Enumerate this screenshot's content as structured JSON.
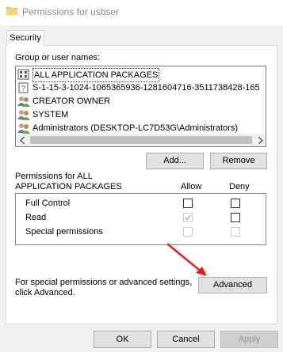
{
  "window": {
    "title": "Permissions for usbser"
  },
  "tabs": [
    {
      "label": "Security"
    }
  ],
  "group_list": {
    "label": "Group or user names:",
    "items": [
      {
        "name": "ALL APPLICATION PACKAGES",
        "icon": "package-group-icon",
        "selected": true
      },
      {
        "name": "S-1-15-3-1024-1065365936-1281604716-3511738428-165",
        "icon": "unknown-sid-icon"
      },
      {
        "name": "CREATOR OWNER",
        "icon": "users-icon"
      },
      {
        "name": "SYSTEM",
        "icon": "users-icon"
      },
      {
        "name": "Administrators (DESKTOP-LC7D53G\\Administrators)",
        "icon": "users-icon"
      }
    ]
  },
  "buttons": {
    "add": "Add...",
    "remove": "Remove",
    "advanced": "Advanced",
    "ok": "OK",
    "cancel": "Cancel",
    "apply": "Apply"
  },
  "permissions": {
    "title_line1": "Permissions for ALL",
    "title_line2": "APPLICATION PACKAGES",
    "col_allow": "Allow",
    "col_deny": "Deny",
    "rows": [
      {
        "name": "Full Control",
        "allow": false,
        "deny": false,
        "enabled": true
      },
      {
        "name": "Read",
        "allow": true,
        "deny": false,
        "enabled": true,
        "allow_disabled": true
      },
      {
        "name": "Special permissions",
        "allow": false,
        "deny": false,
        "enabled": false
      }
    ]
  },
  "advanced_note": {
    "line1": "For special permissions or advanced settings,",
    "line2": "click Advanced."
  },
  "annotation": {
    "color": "#e81c1c",
    "target": "Advanced"
  }
}
